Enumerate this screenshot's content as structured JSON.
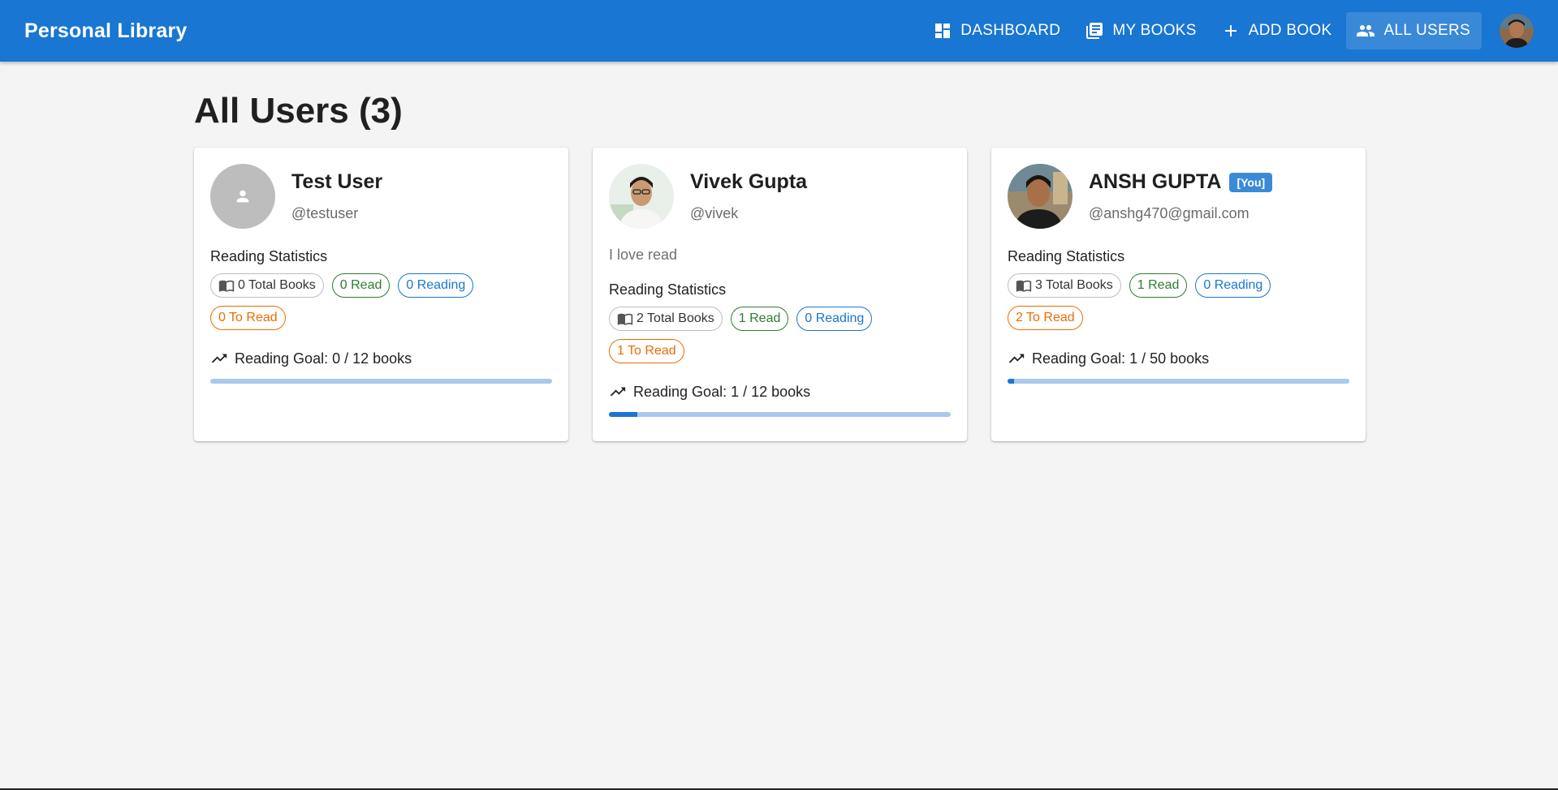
{
  "app": {
    "title": "Personal Library",
    "nav": [
      {
        "label": "DASHBOARD",
        "icon": "dashboard-icon"
      },
      {
        "label": "MY BOOKS",
        "icon": "library-books-icon"
      },
      {
        "label": "ADD BOOK",
        "icon": "add-icon"
      },
      {
        "label": "ALL USERS",
        "icon": "people-icon",
        "active": true
      }
    ],
    "avatar": "user-avatar"
  },
  "page": {
    "title": "All Users (3)"
  },
  "colors": {
    "primary": "#1976d2",
    "success": "#2e7d32",
    "warning": "#ed6c02"
  },
  "users": [
    {
      "name": "Test User",
      "handle": "@testuser",
      "avatar": "person-icon",
      "stats_title": "Reading Statistics",
      "total": "0 Total Books",
      "read": "0 Read",
      "reading": "0 Reading",
      "to_read": "0 To Read",
      "goal": "Reading Goal: 0 / 12 books",
      "goal_progress": 0
    },
    {
      "name": "Vivek Gupta",
      "handle": "@vivek",
      "bio": "I love read",
      "avatar": "profile-photo",
      "stats_title": "Reading Statistics",
      "total": "2 Total Books",
      "read": "1 Read",
      "reading": "0 Reading",
      "to_read": "1 To Read",
      "goal": "Reading Goal: 1 / 12 books",
      "goal_progress": 0.083
    },
    {
      "name": "ANSH GUPTA",
      "badge": "[You]",
      "handle": "@anshg470@gmail.com",
      "avatar": "profile-photo",
      "stats_title": "Reading Statistics",
      "total": "3 Total Books",
      "read": "1 Read",
      "reading": "0 Reading",
      "to_read": "2 To Read",
      "goal": "Reading Goal: 1 / 50 books",
      "goal_progress": 0.02
    }
  ]
}
